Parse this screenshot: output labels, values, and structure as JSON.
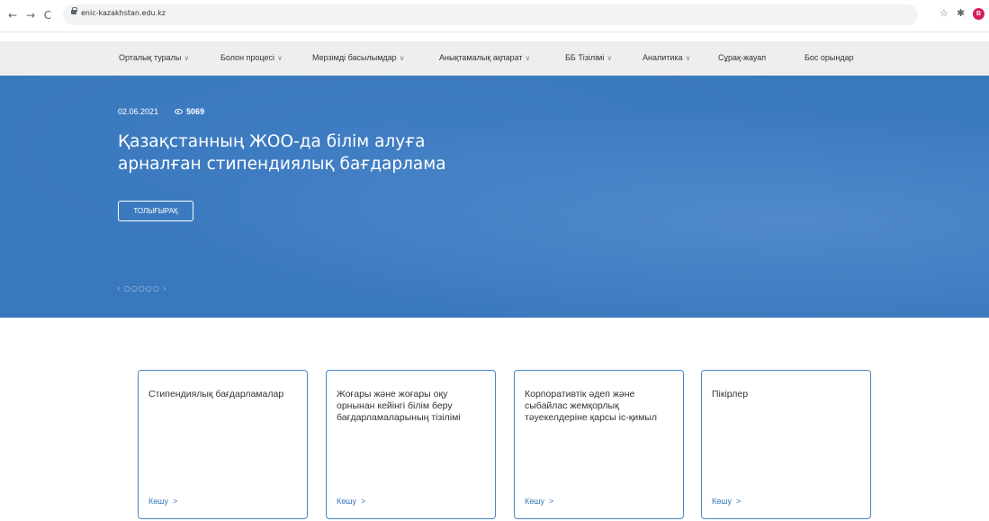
{
  "browser": {
    "url": "enic-kazakhstan.edu.kz",
    "back_glyph": "←",
    "forward_glyph": "→",
    "reload_glyph": "C",
    "star_glyph": "☆",
    "ext_glyph": "✱",
    "profile_initial": "B",
    "profile_color": "#d81b60"
  },
  "nav": {
    "items": [
      {
        "label": "Орталық туралы",
        "dropdown": true
      },
      {
        "label": "Болон процесі",
        "dropdown": true
      },
      {
        "label": "Мерзімді басылымдар",
        "dropdown": true
      },
      {
        "label": "Анықтамалық ақпарат",
        "dropdown": true
      },
      {
        "label": "ББ Тізілімі",
        "dropdown": true
      },
      {
        "label": "Аналитика",
        "dropdown": true
      },
      {
        "label": "Сұрақ-жауап",
        "dropdown": false
      },
      {
        "label": "Бос орындар",
        "dropdown": false
      }
    ]
  },
  "hero": {
    "date": "02.06.2021",
    "views": "5069",
    "title": "Қазақстанның ЖОО-да білім алуға арналған стипендиялық бағдарлама",
    "more_label": "ТОЛЫҒЫРАҚ",
    "dots": "‹ ○○○○○ ›",
    "bg_color": "#3a78bd"
  },
  "cards": [
    {
      "title": "Стипендиялық бағдарламалар",
      "link": "Көшу"
    },
    {
      "title": "Жоғары және жоғары оқу орнынан кейінгі білім беру бағдарламаларының тізілімі",
      "link": "Көшу"
    },
    {
      "title": "Корпоративтік әдеп және сыбайлас жемқорлық тәуекелдеріне қарсы іс-қимыл",
      "link": "Көшу"
    },
    {
      "title": "Пікірлер",
      "link": "Көшу"
    }
  ],
  "accent_color": "#4a86c5"
}
